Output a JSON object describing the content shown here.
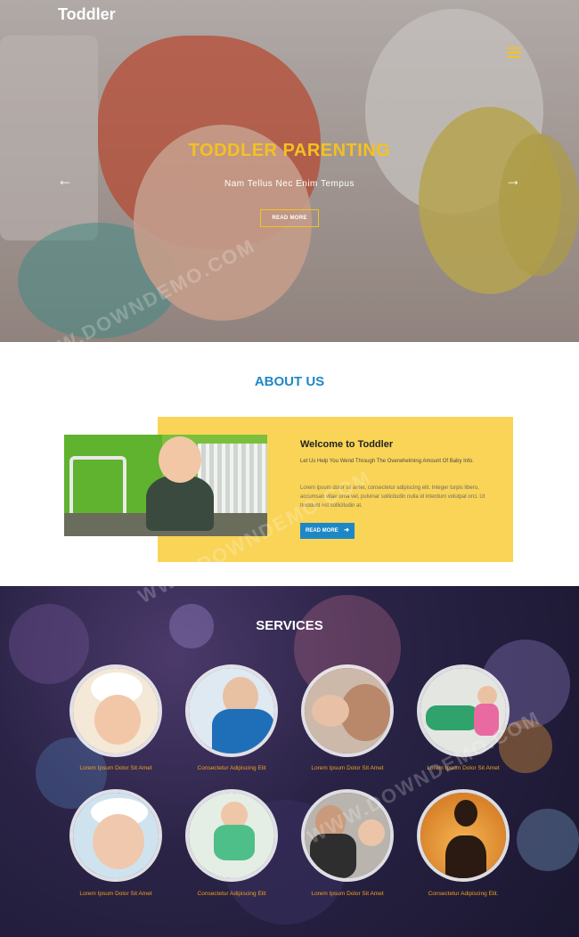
{
  "brand": {
    "name": "Toddler"
  },
  "hero": {
    "title": "TODDLER PARENTING",
    "subtitle": "Nam Tellus Nec Enim Tempus",
    "button_label": "READ MORE",
    "prev_arrow": "←",
    "next_arrow": "→"
  },
  "about": {
    "title": "ABOUT US",
    "heading": "Welcome to Toddler",
    "lead": "Let Us Help You Wend Through The Overwhelming Amount Of Baby Info.",
    "body": "Lorem ipsum dolor sit amet, consectetur adipiscing elit. Integer turpis libero, accumsan vitae urna vel, pulvinar sollicitudin nulla id interdum volutpat orci. Ut tincidunt est sollicitudin at.",
    "button_label": "READ MORE",
    "button_icon": "➜"
  },
  "services": {
    "title": "SERVICES",
    "items": [
      {
        "caption": "Lorem Ipsum Dolor Sit Amet",
        "icon": "chef-baby-photo"
      },
      {
        "caption": "Consectetur Adipiscing Elit",
        "icon": "doctor-photo"
      },
      {
        "caption": "Lorem Ipsum Dolor Sit Amet",
        "icon": "father-baby-photo"
      },
      {
        "caption": "Lorem Ipsum Dolor Sit Amet",
        "icon": "toy-car-photo"
      },
      {
        "caption": "Lorem Ipsum Dolor Sit Amet",
        "icon": "bath-baby-photo"
      },
      {
        "caption": "Consectetur Adipiscing Elit",
        "icon": "walking-baby-photo"
      },
      {
        "caption": "Lorem Ipsum Dolor Sit Amet",
        "icon": "parent-child-photo"
      },
      {
        "caption": "Consectetur Adipiscing Elit.",
        "icon": "silhouette-photo"
      }
    ]
  },
  "watermark": {
    "text": "WWW.DOWNDEMO.COM"
  },
  "colors": {
    "accent_yellow": "#f3c21f",
    "accent_blue": "#1e88c7",
    "card_yellow": "#f9d456",
    "caption_orange": "#f0a020"
  }
}
